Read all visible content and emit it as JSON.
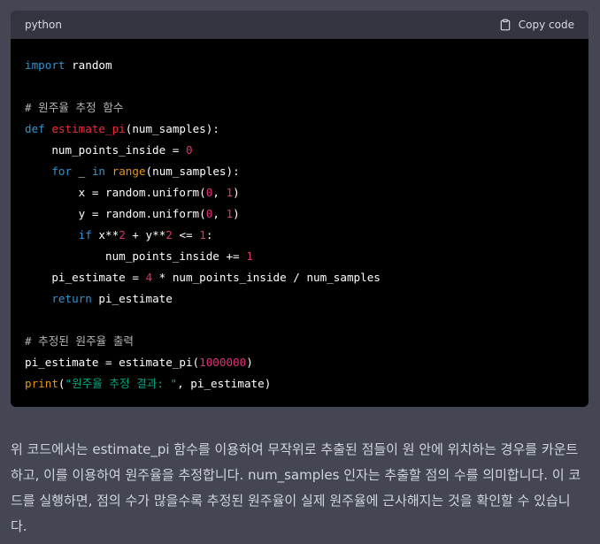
{
  "code_block": {
    "language": "python",
    "copy_label": "Copy code",
    "lines": [
      "import random",
      "",
      "# 원주율 추정 함수",
      "def estimate_pi(num_samples):",
      "    num_points_inside = 0",
      "    for _ in range(num_samples):",
      "        x = random.uniform(0, 1)",
      "        y = random.uniform(0, 1)",
      "        if x**2 + y**2 <= 1:",
      "            num_points_inside += 1",
      "    pi_estimate = 4 * num_points_inside / num_samples",
      "    return pi_estimate",
      "",
      "# 추정된 원주율 출력",
      "pi_estimate = estimate_pi(1000000)",
      "print(\"원주율 추정 결과: \", pi_estimate)"
    ]
  },
  "explanation": "위 코드에서는 estimate_pi 함수를 이용하여 무작위로 추출된 점들이 원 안에 위치하는 경우를 카운트하고, 이를 이용하여 원주율을 추정합니다. num_samples 인자는 추출할 점의 수를 의미합니다. 이 코드를 실행하면, 점의 수가 많을수록 추정된 원주율이 실제 원주율에 근사해지는 것을 확인할 수 있습니다.",
  "colors": {
    "background": "#444654",
    "code_bg": "#000000",
    "header_bg": "#343541",
    "keyword": "#2e95d3",
    "function": "#f22c3d",
    "number": "#df3079",
    "builtin": "#e9950c",
    "string": "#00a67d"
  }
}
